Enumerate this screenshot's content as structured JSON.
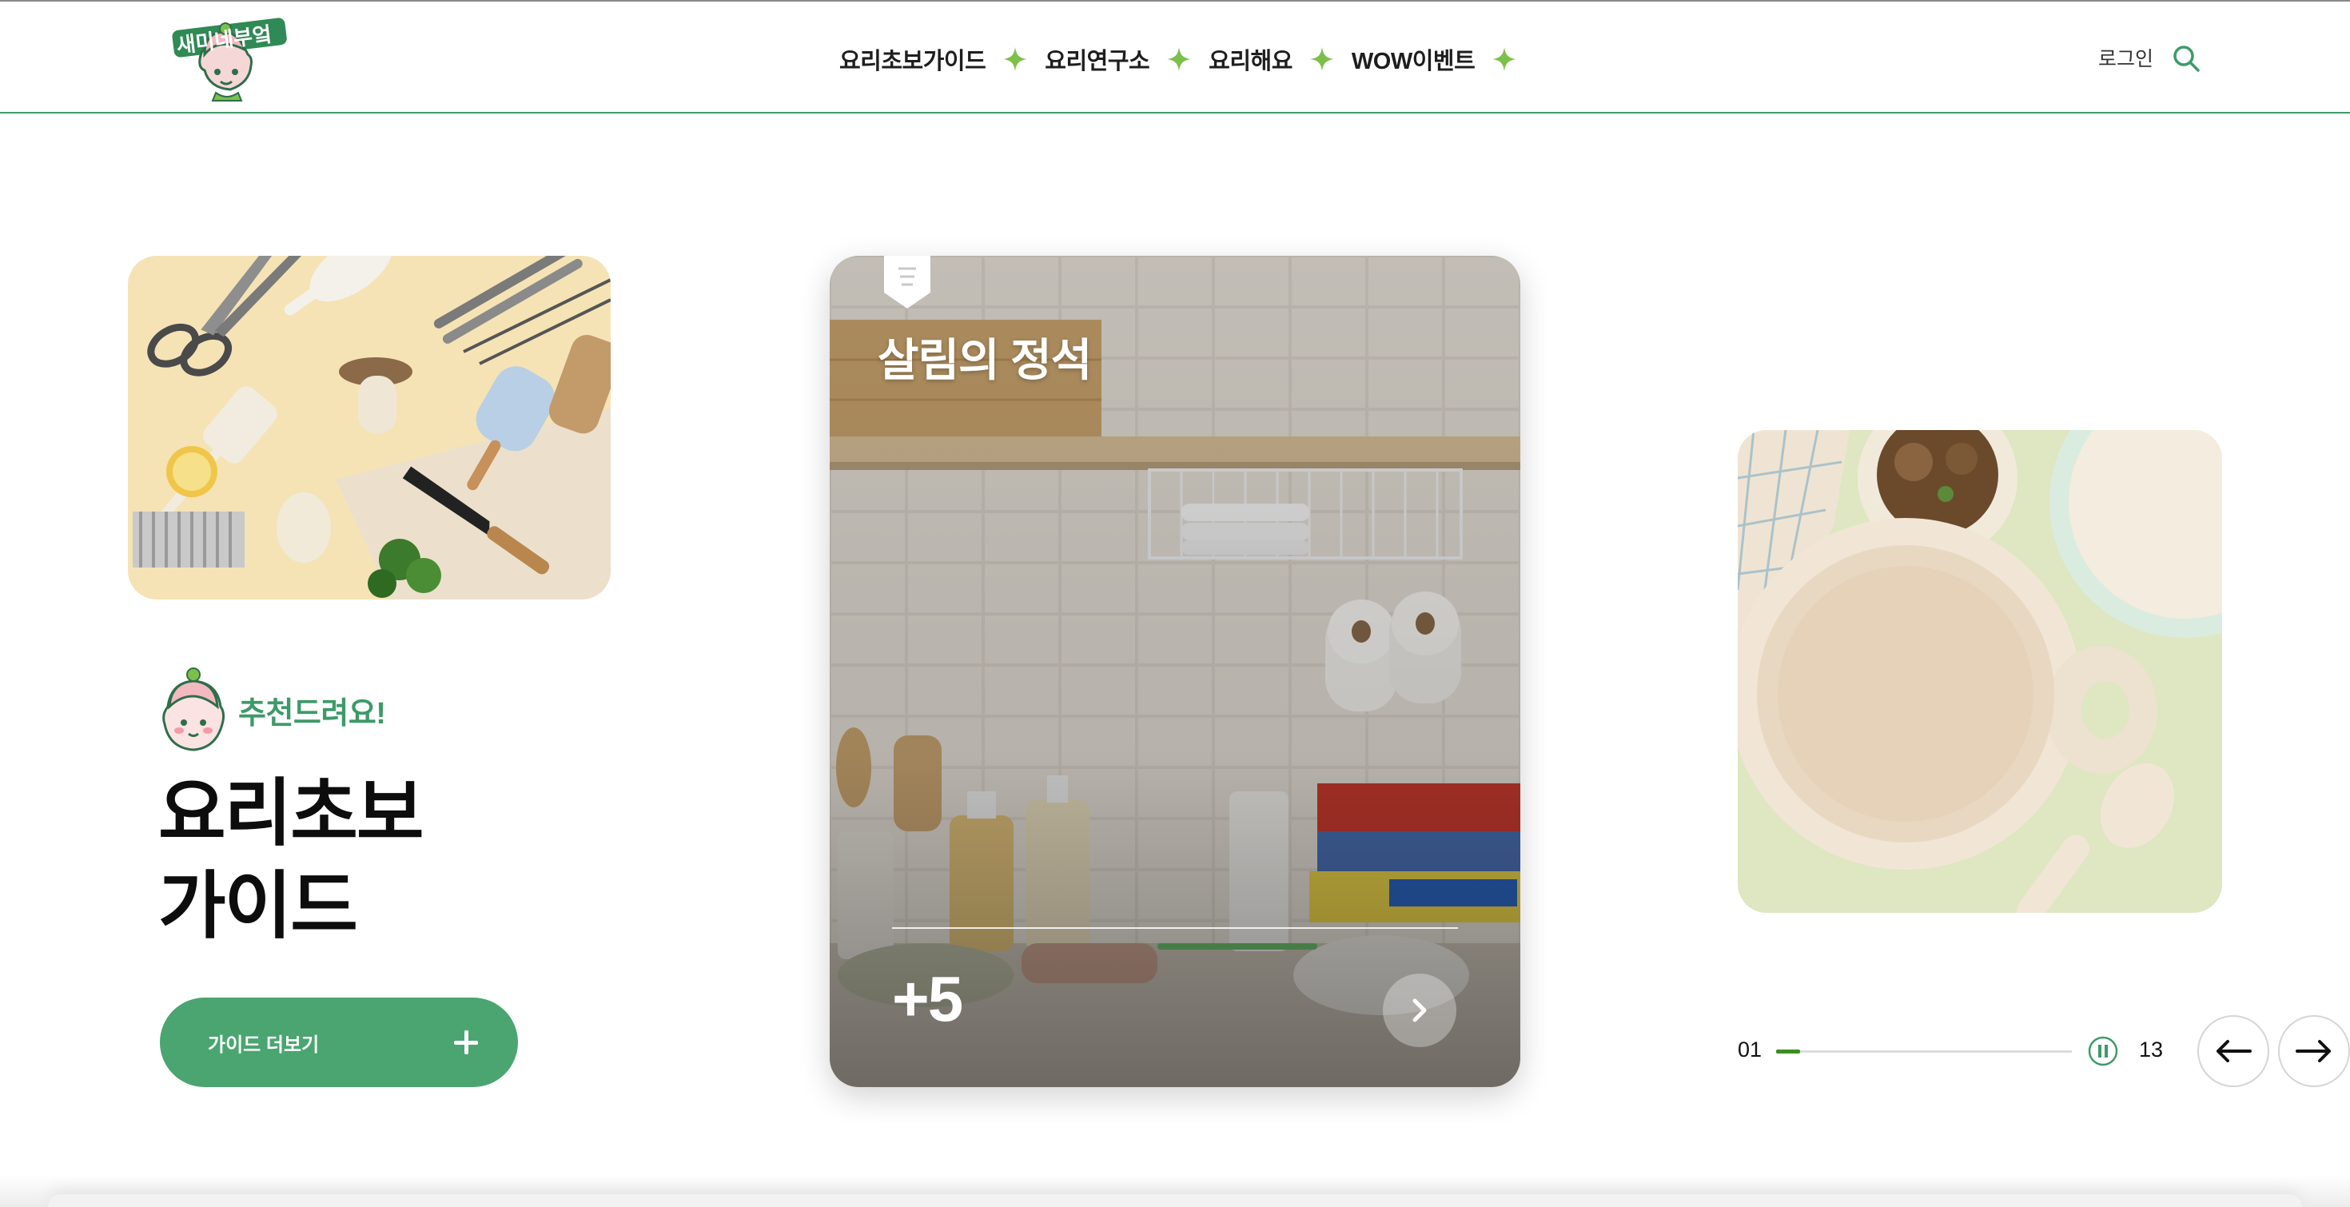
{
  "header": {
    "logo_text": "새미네부엌",
    "nav": [
      {
        "label": "요리초보가이드"
      },
      {
        "label": "요리연구소"
      },
      {
        "label": "요리해요"
      },
      {
        "label": "WOW이벤트"
      }
    ],
    "login_label": "로그인"
  },
  "hero": {
    "recommend_label": "추천드려요!",
    "title_line1": "요리초보",
    "title_line2": "가이드",
    "button_label": "가이드 더보기"
  },
  "center_card": {
    "title": "살림의 정석",
    "count_label": "+5"
  },
  "pager": {
    "current": "01",
    "total": "13",
    "progress": 0.08
  },
  "colors": {
    "brand_green": "#4aa570",
    "nav_star": "#7cc04a",
    "progress": "#3a8f1f"
  }
}
